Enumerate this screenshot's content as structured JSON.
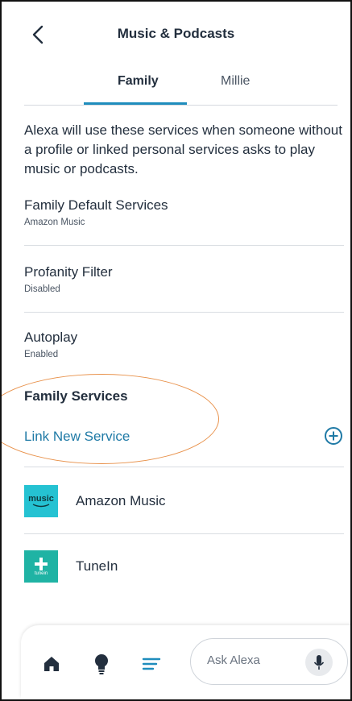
{
  "header": {
    "title": "Music & Podcasts"
  },
  "tabs": [
    {
      "label": "Family",
      "active": true
    },
    {
      "label": "Millie",
      "active": false
    }
  ],
  "intro": "Alexa will use these services when someone without a profile or linked personal services asks to play music or podcasts.",
  "settings": [
    {
      "name": "Family Default Services",
      "value": "Amazon Music"
    },
    {
      "name": "Profanity Filter",
      "value": "Disabled"
    },
    {
      "name": "Autoplay",
      "value": "Enabled"
    }
  ],
  "family_services": {
    "title": "Family Services",
    "link_label": "Link New Service",
    "services": [
      {
        "name": "Amazon Music",
        "logo_text": "music"
      },
      {
        "name": "TuneIn",
        "logo_text": "tunein"
      }
    ]
  },
  "bottom_bar": {
    "ask_placeholder": "Ask Alexa",
    "icons": [
      "home-icon",
      "lightbulb-icon",
      "menu-icon",
      "microphone-icon"
    ]
  },
  "colors": {
    "accent": "#1f8dbd",
    "link": "#1f7aa6",
    "text": "#232f3e",
    "annotation": "#e8914a"
  }
}
